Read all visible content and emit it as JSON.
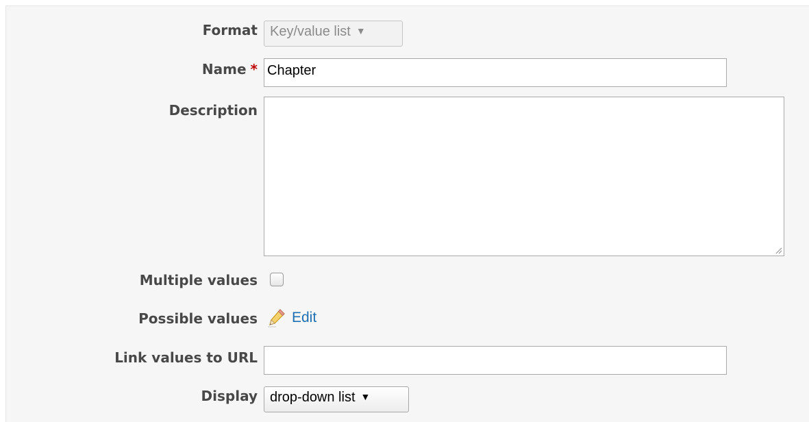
{
  "form": {
    "format": {
      "label": "Format",
      "value": "Key/value list",
      "caret": "▼",
      "disabled": true
    },
    "name": {
      "label": "Name",
      "required_marker": "*",
      "value": "Chapter"
    },
    "description": {
      "label": "Description",
      "value": ""
    },
    "multiple_values": {
      "label": "Multiple values",
      "checked": false
    },
    "possible_values": {
      "label": "Possible values",
      "edit_label": "Edit",
      "icon": "pencil-icon"
    },
    "link_values_to_url": {
      "label": "Link values to URL",
      "value": ""
    },
    "display": {
      "label": "Display",
      "value": "drop-down list",
      "caret": "▼"
    }
  },
  "colors": {
    "panel_background": "#f6f6f6",
    "label_text": "#484848",
    "required_marker": "#bb0000",
    "link": "#1f6fb3"
  }
}
